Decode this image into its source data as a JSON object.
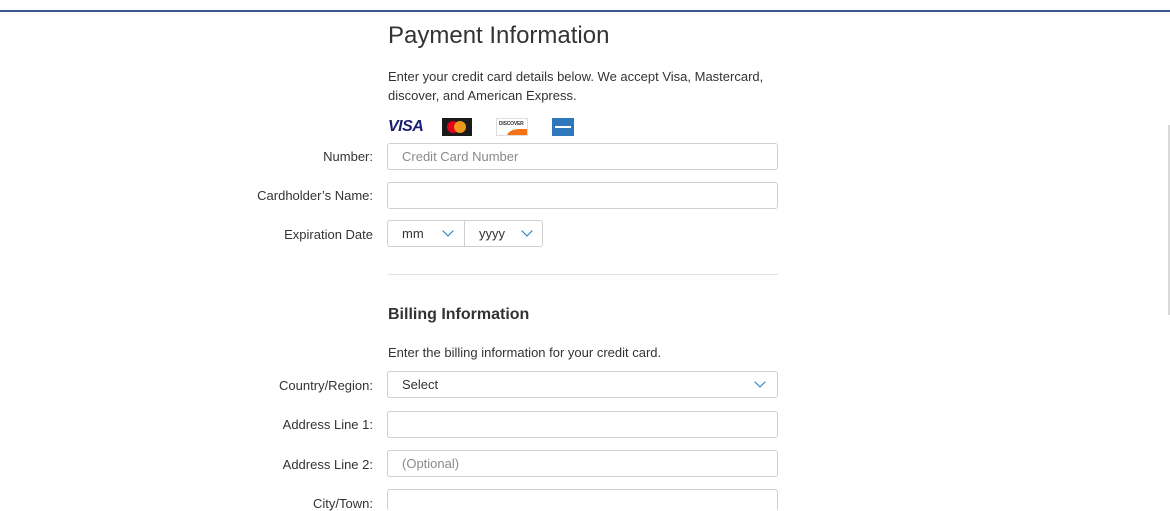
{
  "payment": {
    "title": "Payment Information",
    "description": "Enter your credit card details below. We accept Visa, Mastercard, discover, and American Express.",
    "accepted_cards": [
      "visa-icon",
      "mastercard-icon",
      "discover-icon",
      "amex-icon"
    ],
    "cards_brand_text": {
      "visa": "VISA",
      "discover": "DISCOVER"
    },
    "number_label": "Number:",
    "number_placeholder": "Credit Card Number",
    "name_label": "Cardholder’s Name:",
    "name_value": "",
    "expiration_label": "Expiration Date",
    "month_selected": "mm",
    "year_selected": "yyyy"
  },
  "billing": {
    "title": "Billing Information",
    "description": "Enter the billing information for your credit card.",
    "country_label": "Country/Region:",
    "country_selected": "Select",
    "address1_label": "Address Line 1:",
    "address1_value": "",
    "address2_label": "Address Line 2:",
    "address2_placeholder": "(Optional)",
    "city_label": "City/Town:",
    "city_value": ""
  },
  "colors": {
    "accent": "#0f79c7",
    "top_rule": "#3b5a8c",
    "border": "#cfcfcf",
    "text": "#333333"
  }
}
